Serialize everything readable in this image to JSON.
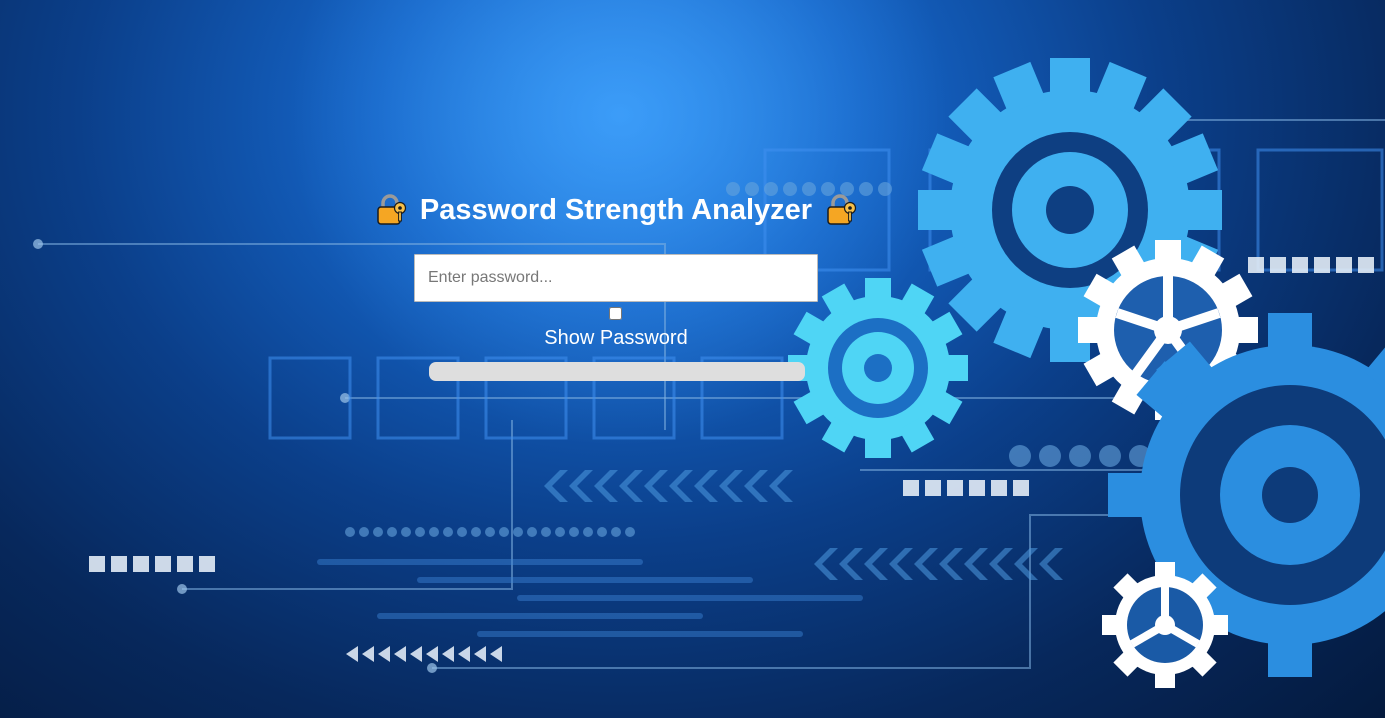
{
  "app": {
    "title": "Password Strength Analyzer",
    "title_icon": "locked-with-key-icon"
  },
  "password": {
    "value": "",
    "placeholder": "Enter password..."
  },
  "show_password": {
    "label": "Show Password",
    "checked": false
  },
  "strength": {
    "level": 0
  },
  "colors": {
    "background_accent": "#1e88e5",
    "gear_light": "#4fc3f7",
    "gear_white": "#ffffff",
    "strength_track": "#dedede",
    "lock_gold": "#f5a623"
  }
}
